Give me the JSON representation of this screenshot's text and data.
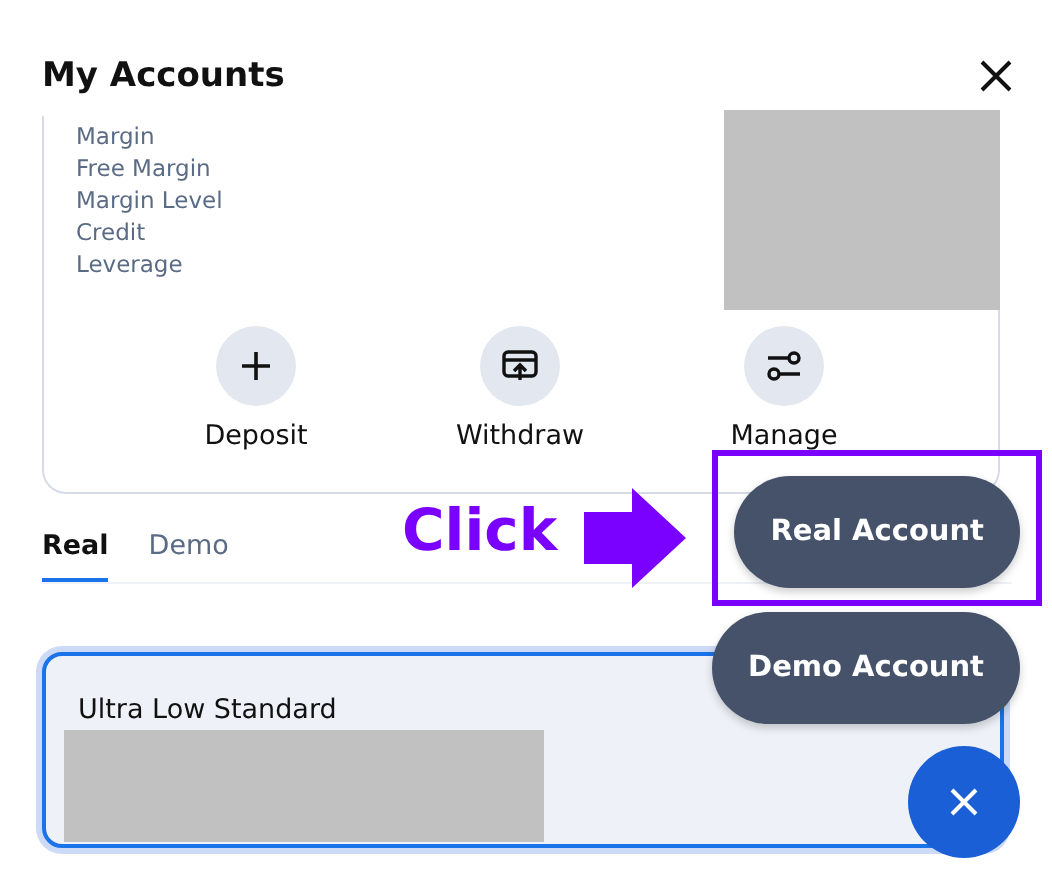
{
  "header": {
    "title": "My Accounts"
  },
  "summary": {
    "labels": [
      "Margin",
      "Free Margin",
      "Margin Level",
      "Credit",
      "Leverage"
    ],
    "actions": [
      {
        "label": "Deposit",
        "kind": "plus"
      },
      {
        "label": "Withdraw",
        "kind": "withdraw"
      },
      {
        "label": "Manage",
        "kind": "sliders"
      }
    ]
  },
  "tabs": [
    {
      "label": "Real",
      "selected": true
    },
    {
      "label": "Demo",
      "selected": false
    }
  ],
  "accounts": [
    {
      "name": "Ultra Low Standard",
      "selected": true
    }
  ],
  "fab_menu": {
    "expanded": true,
    "items": [
      {
        "label": "Real Account",
        "highlighted": true
      },
      {
        "label": "Demo Account",
        "highlighted": false
      }
    ]
  },
  "annotation": {
    "text": "Click"
  }
}
